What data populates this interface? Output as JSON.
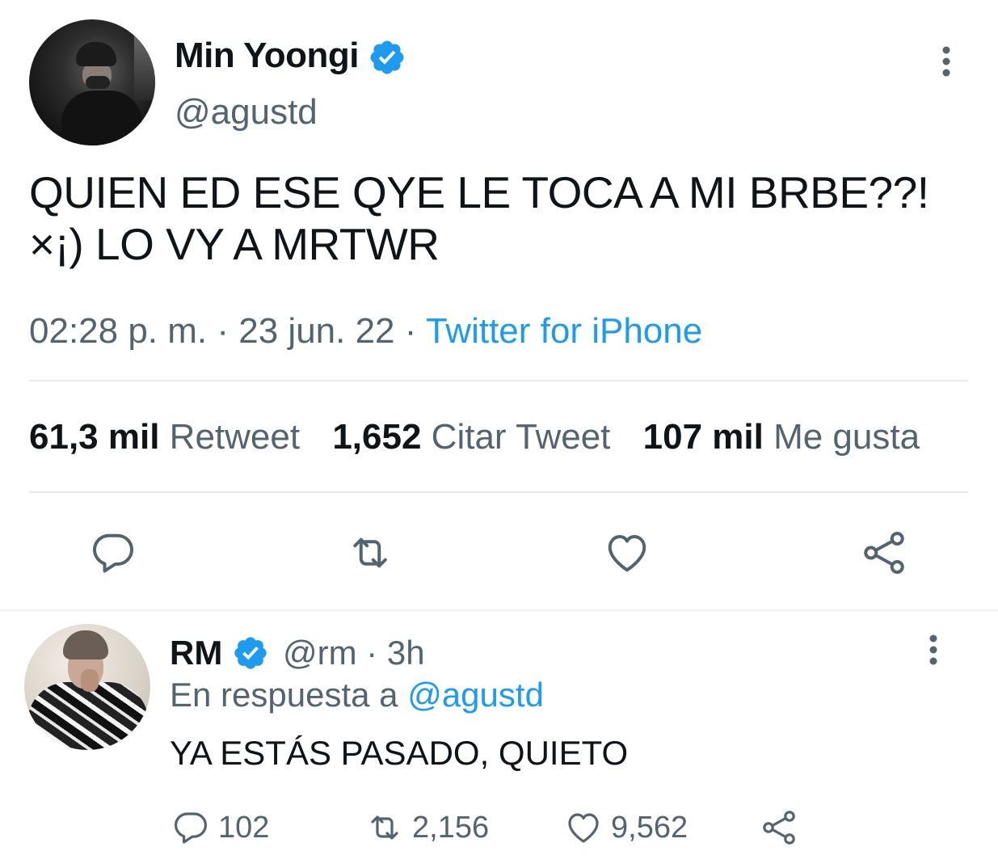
{
  "main_tweet": {
    "author_name": "Min Yoongi",
    "verified": true,
    "handle": "@agustd",
    "avatar": "user-avatar-photo",
    "text_line1": "QUIEN ED ESE QYE LE TOCA A MI BRBE??!",
    "text_line2": "×¡) LO VY A MRTWR",
    "time": "02:28 p. m.",
    "separator": " · ",
    "date": "23 jun. 22",
    "source": "Twitter for iPhone",
    "stats": {
      "retweets_count": "61,3 mil",
      "retweets_label": "Retweet",
      "quotes_count": "1,652",
      "quotes_label": "Citar Tweet",
      "likes_count": "107 mil",
      "likes_label": "Me gusta"
    },
    "actions": [
      "reply-icon",
      "retweet-icon",
      "like-icon",
      "share-icon"
    ]
  },
  "reply_tweet": {
    "author_name": "RM",
    "verified": true,
    "handle_time": "@rm · 3h",
    "avatar": "user-avatar-photo",
    "reply_prefix": "En respuesta a ",
    "reply_mention": "@agustd",
    "text": "YA ESTÁS PASADO, QUIETO",
    "reply_count": "102",
    "retweet_count": "2,156",
    "like_count": "9,562",
    "actions": [
      "reply-icon",
      "retweet-icon",
      "like-icon",
      "share-icon"
    ]
  },
  "colors": {
    "text_primary": "#0f1419",
    "text_secondary": "#536471",
    "accent": "#1d9bf0",
    "divider": "#e7e9ea"
  }
}
